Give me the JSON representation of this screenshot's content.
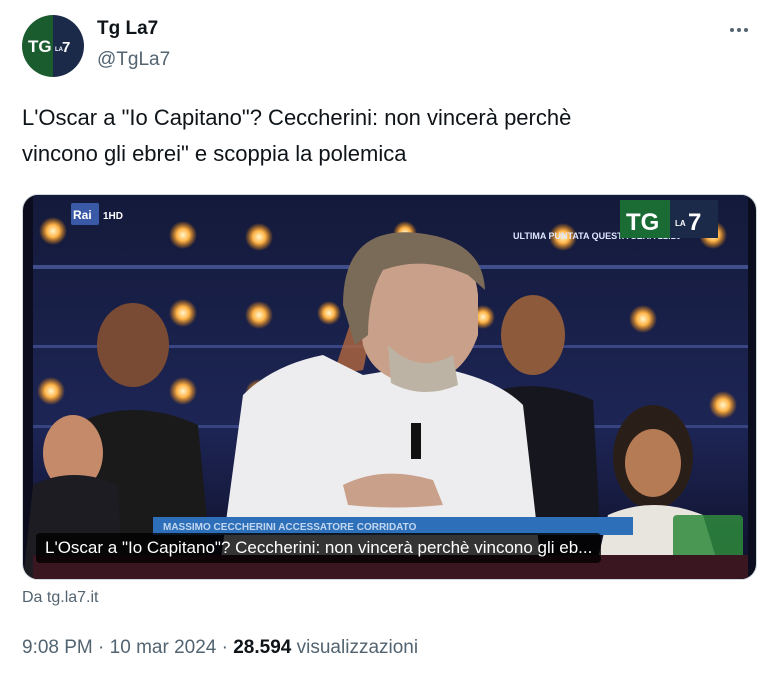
{
  "author": {
    "name": "Tg La7",
    "handle": "@TgLa7",
    "avatar_text": "TG",
    "avatar_small": "LA",
    "avatar_num": "7"
  },
  "tweet": {
    "text_line1": "L'Oscar a \"Io Capitano\"? Ceccherini: non vincerà perchè",
    "text_line2": "vincono gli ebrei\" e scoppia la polemica"
  },
  "card": {
    "title": "L'Oscar a \"Io Capitano\"? Ceccherini: non vincerà perchè vincono gli eb...",
    "domain": "Da tg.la7.it",
    "logo_tg": "TG",
    "logo_la": "LA",
    "logo_7": "7",
    "channel_badge": "Rai 1 HD",
    "banner_text": "ULTIMA PUNTATA QUESTA SERA 21:20",
    "lower_third": "MASSIMO CECCHERINI ACCESSATORE CORRIDATO"
  },
  "meta": {
    "time": "9:08 PM",
    "separator1": "·",
    "date": "10 mar 2024",
    "separator2": "·",
    "views_count": "28.594",
    "views_label": "visualizzazioni"
  },
  "colors": {
    "text_primary": "#0f1419",
    "text_secondary": "#536471",
    "tg_green": "#1a5c2e",
    "tg_navy": "#1c2a4a"
  },
  "icons": {
    "more": "more-horizontal-icon"
  }
}
